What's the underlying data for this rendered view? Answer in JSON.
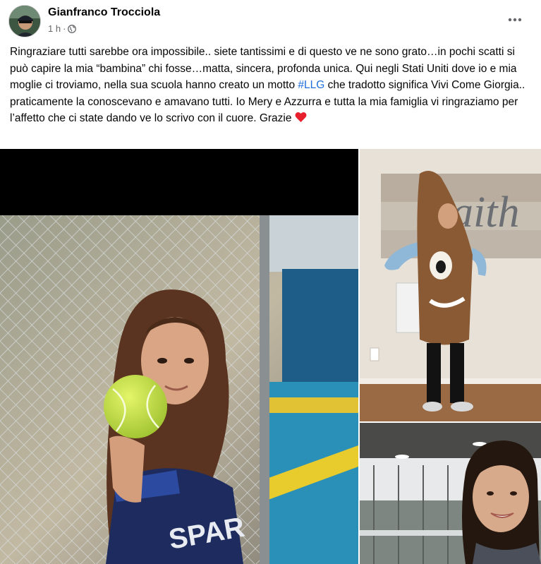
{
  "post": {
    "author": "Gianfranco Trocciola",
    "time": "1 h",
    "separator": "·",
    "text_part1": "Ringraziare tutti sarebbe ora impossibile.. siete tantissimi e di questo ve ne sono grato…in pochi scatti si può capire la mia “bambina” chi fosse…matta, sincera, profonda unica. Qui negli Stati Uniti dove io e mia moglie ci troviamo, nella sua scuola hanno creato un motto ",
    "hashtag": "#LLG",
    "text_part2": " che tradotto significa Vivi Come Giorgia.. praticamente la conoscevano e amavano tutti. Io Mery e Azzurra e tutta la mia famiglia vi ringraziamo per l’affetto che ci state dando ve lo scrivo con il cuore. Grazie ",
    "jersey_text": "SPAR",
    "wall_sign_text": "aith"
  },
  "icons": {
    "globe": "globe-icon",
    "more": "more-options-icon",
    "heart": "red-heart-emoji",
    "speaker": "speaker-icon"
  },
  "colors": {
    "hashtag": "#216fdb",
    "meta": "#65676b",
    "heart": "#e8202e"
  }
}
